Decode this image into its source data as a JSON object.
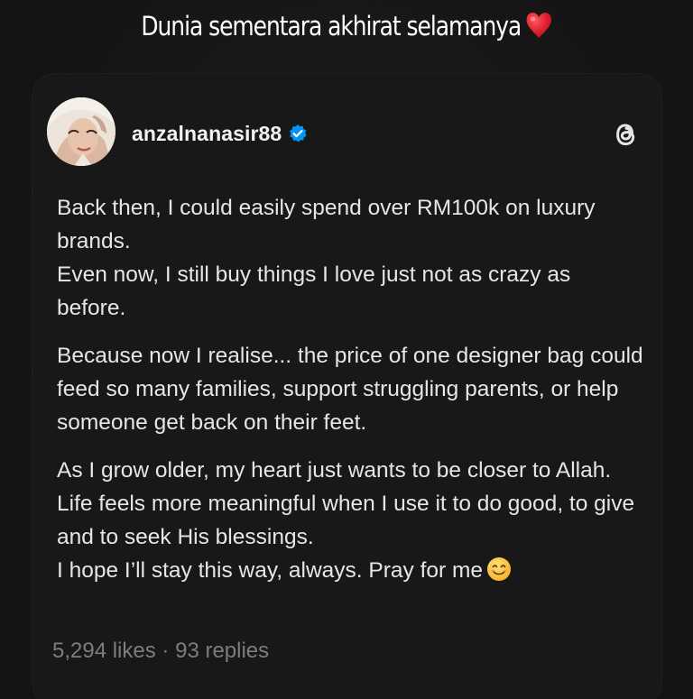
{
  "story": {
    "caption": "Dunia sementara akhirat selamanya",
    "caption_emoji": "red-heart-emoji"
  },
  "post": {
    "username": "anzalnanasir88",
    "verified": true,
    "platform_icon": "threads-logo-icon",
    "paragraphs": [
      "Back then, I could easily spend over RM100k on luxury brands.",
      "Even now, I still buy things I love just not as crazy as before.",
      "Because now I realise... the price of one designer bag could feed so many families, support struggling parents, or help someone get back on their feet.",
      "As I grow older, my heart just wants to be closer to Allah.",
      "Life feels more meaningful when I use it to do good, to give and to seek His blessings.",
      "I hope I’ll stay this way, always. Pray for me"
    ],
    "final_emoji": "smiling-face-emoji",
    "likes": "5,294 likes",
    "separator": "·",
    "replies": "93 replies"
  },
  "colors": {
    "background": "#141414",
    "card": "#181818",
    "text": "#e6e6e6",
    "muted": "#7d7d7d",
    "verified_blue": "#0095f6",
    "heart_red": "#e0202f"
  }
}
